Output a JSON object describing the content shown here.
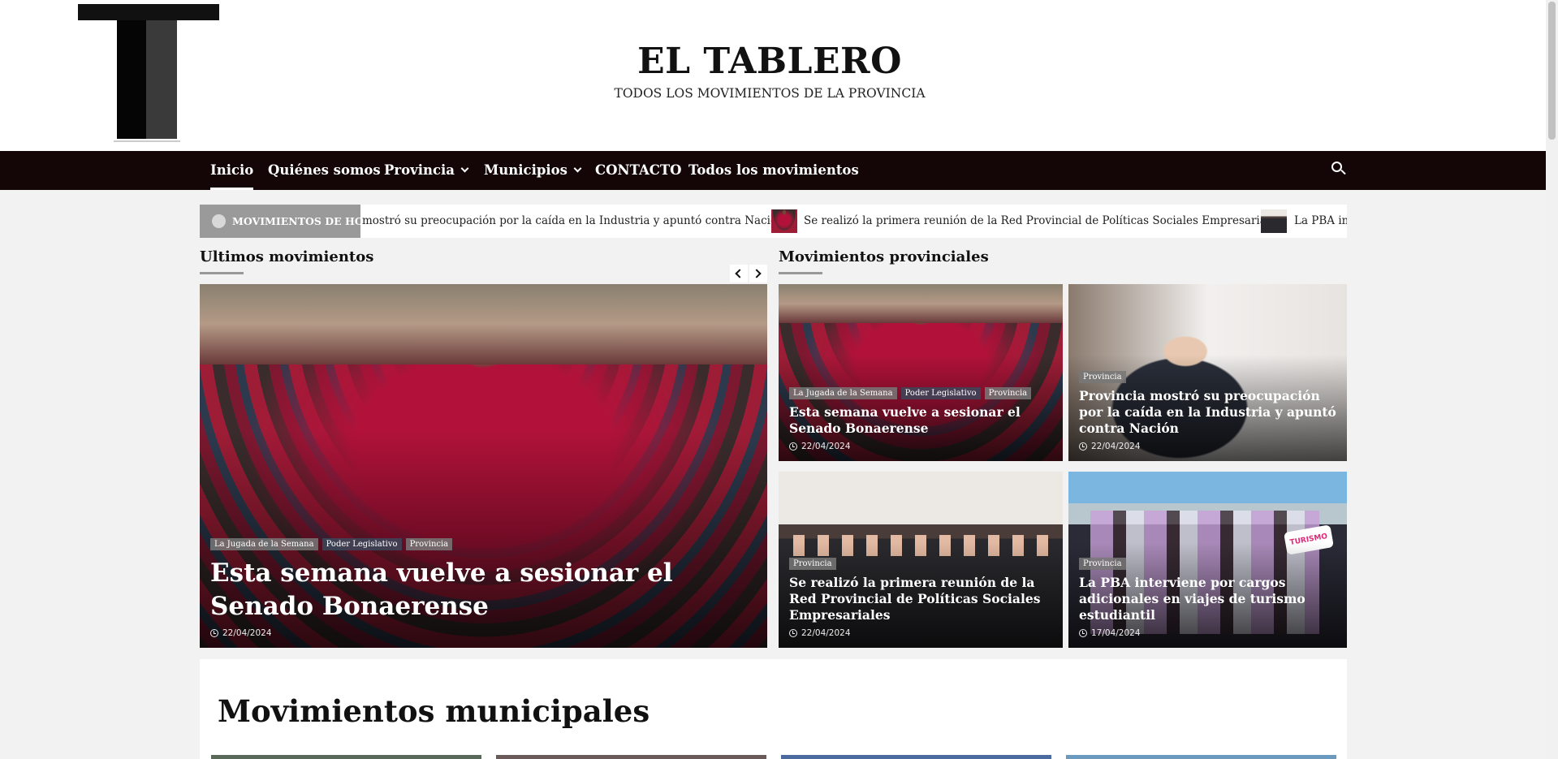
{
  "site": {
    "title": "EL TABLERO",
    "tagline": "TODOS LOS MOVIMIENTOS DE LA PROVINCIA"
  },
  "nav": {
    "items": [
      {
        "label": "Inicio",
        "active": true
      },
      {
        "label": "Quiénes somos"
      },
      {
        "label": "Provincia",
        "dropdown": true
      },
      {
        "label": "Municipios",
        "dropdown": true
      },
      {
        "label": "CONTACTO"
      },
      {
        "label": "Todos los movimientos"
      }
    ],
    "search_icon": "search-icon"
  },
  "ticker": {
    "label": "MOVIMIENTOS DE HOY",
    "items": [
      "mostró su preocupación por la caída en la Industria y apuntó contra Nación",
      "Se realizó la primera reunión de la Red Provincial de Políticas Sociales Empresariales",
      "La PBA interviene por cargos adicionales en viajes de turismo estudiantil"
    ]
  },
  "latest": {
    "heading": "Ultimos movimientos",
    "featured": {
      "categories": [
        "La Jugada de la Semana",
        "Poder Legislativo",
        "Provincia"
      ],
      "title": "Esta semana vuelve a sesionar el Senado Bonaerense",
      "date": "22/04/2024"
    }
  },
  "provincial": {
    "heading": "Movimientos provinciales",
    "cards": [
      {
        "categories": [
          "La Jugada de la Semana",
          "Poder Legislativo",
          "Provincia"
        ],
        "title": "Esta semana vuelve a sesionar el Senado Bonaerense",
        "date": "22/04/2024"
      },
      {
        "categories": [
          "Provincia"
        ],
        "title": "Provincia mostró su preocupación por la caída en la Industria y apuntó contra Nación",
        "date": "22/04/2024"
      },
      {
        "categories": [
          "Provincia"
        ],
        "title": "Se realizó la primera reunión de la Red Provincial de Políticas Sociales Empresariales",
        "date": "22/04/2024"
      },
      {
        "categories": [
          "Provincia"
        ],
        "title": "La PBA interviene por cargos adicionales en viajes de turismo estudiantil",
        "date": "17/04/2024",
        "badge": "TURISMO"
      }
    ]
  },
  "municipal": {
    "heading": "Movimientos municipales"
  }
}
